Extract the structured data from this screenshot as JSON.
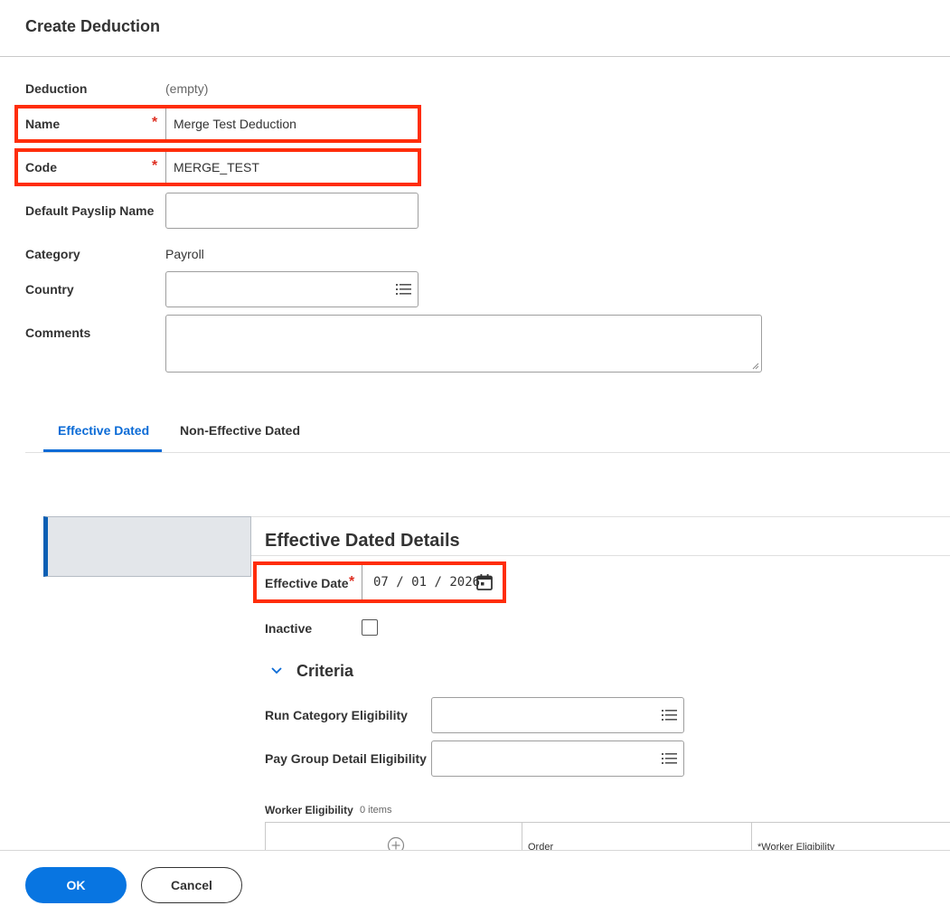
{
  "dialog": {
    "title": "Create Deduction"
  },
  "form": {
    "deduction_label": "Deduction",
    "deduction_value": "(empty)",
    "name_label": "Name",
    "name_value": "Merge Test Deduction",
    "code_label": "Code",
    "code_value": "MERGE_TEST",
    "payslip_label": "Default Payslip Name",
    "payslip_value": "",
    "category_label": "Category",
    "category_value": "Payroll",
    "country_label": "Country",
    "comments_label": "Comments",
    "required_mark": "*"
  },
  "tabs": [
    {
      "label": "Effective Dated",
      "active": true
    },
    {
      "label": "Non-Effective Dated",
      "active": false
    }
  ],
  "details": {
    "title": "Effective Dated Details",
    "effective_date_label": "Effective Date",
    "date_month": "07",
    "date_day": "01",
    "date_year": "2026",
    "date_sep": "/",
    "inactive_label": "Inactive",
    "inactive_checked": false
  },
  "criteria": {
    "title": "Criteria",
    "run_category_label": "Run Category Eligibility",
    "pay_group_label": "Pay Group Detail Eligibility",
    "worker_eligibility_label": "Worker Eligibility",
    "worker_eligibility_count": "0 items",
    "columns": [
      "Order",
      "*Worker Eligibility"
    ]
  },
  "footer": {
    "ok_label": "OK",
    "cancel_label": "Cancel"
  },
  "colors": {
    "accent": "#0875e1",
    "highlight": "#ff2d0a",
    "required": "#de2e21"
  },
  "icons": [
    "list-icon",
    "calendar-icon",
    "chevron-down-icon",
    "plus-circle-icon",
    "checkbox"
  ]
}
